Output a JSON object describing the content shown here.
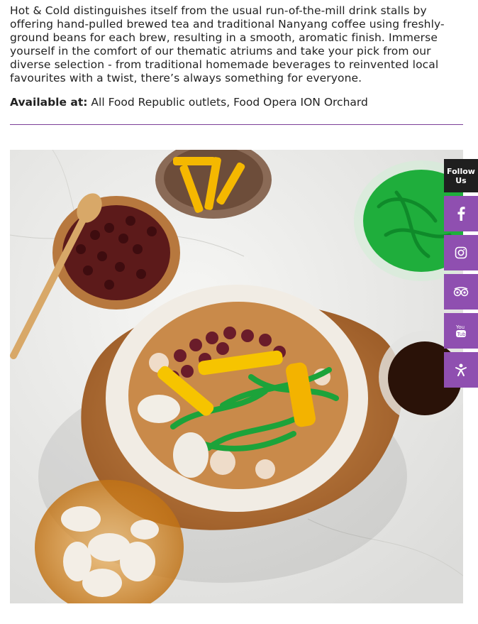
{
  "description": "Hot & Cold distinguishes itself from the usual run-of-the-mill drink stalls by offering hand-pulled brewed tea and traditional Nanyang coffee using freshly-ground beans for each brew, resulting in a smooth, aromatic finish. Immerse yourself in the comfort of our thematic atriums and take your pick from our diverse selection - from traditional homemade beverages to reinvented local favourites with a twist, there’s always something for everyone.",
  "availability": {
    "label": "Available at:",
    "value": "All Food Republic outlets, Food Opera ION Orchard"
  },
  "social": {
    "follow_label": "Follow Us",
    "links": [
      {
        "icon": "facebook-icon"
      },
      {
        "icon": "instagram-icon"
      },
      {
        "icon": "tripadvisor-icon"
      },
      {
        "icon": "youtube-icon"
      },
      {
        "icon": "burpple-icon"
      }
    ]
  },
  "colors": {
    "accent": "#8f4fb0",
    "divider": "#7b3f98",
    "follow_bg": "#1f1f1f"
  }
}
